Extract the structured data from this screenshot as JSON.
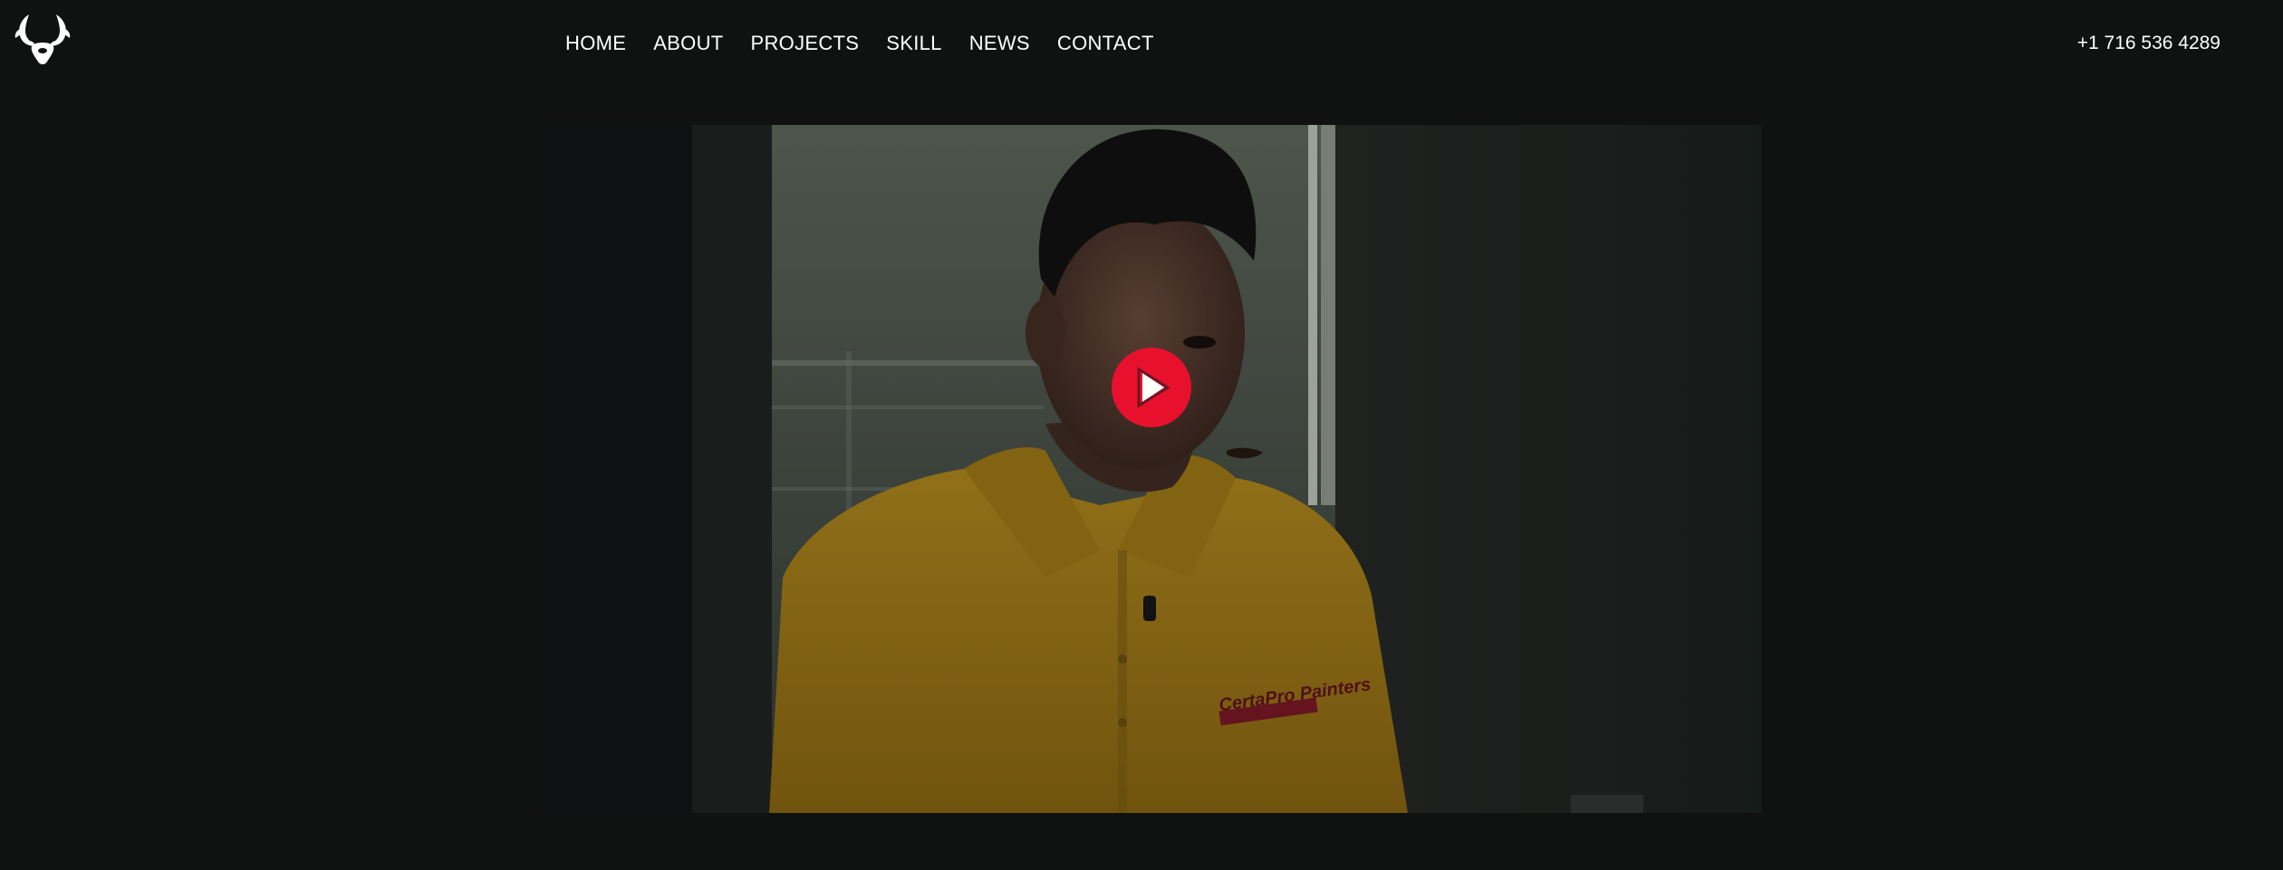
{
  "header": {
    "logo_name": "deer-antlers-logo",
    "nav": [
      {
        "label": "HOME"
      },
      {
        "label": "ABOUT"
      },
      {
        "label": "PROJECTS"
      },
      {
        "label": "SKILL"
      },
      {
        "label": "NEWS"
      },
      {
        "label": "CONTACT"
      }
    ],
    "phone": "+1 716 536 4289"
  },
  "video": {
    "shirt_logo": "CertaPro Painters",
    "play_icon": "play-icon",
    "colors": {
      "play_button": "#e8112d",
      "shirt": "#c79a1c",
      "background": "#101111"
    }
  }
}
